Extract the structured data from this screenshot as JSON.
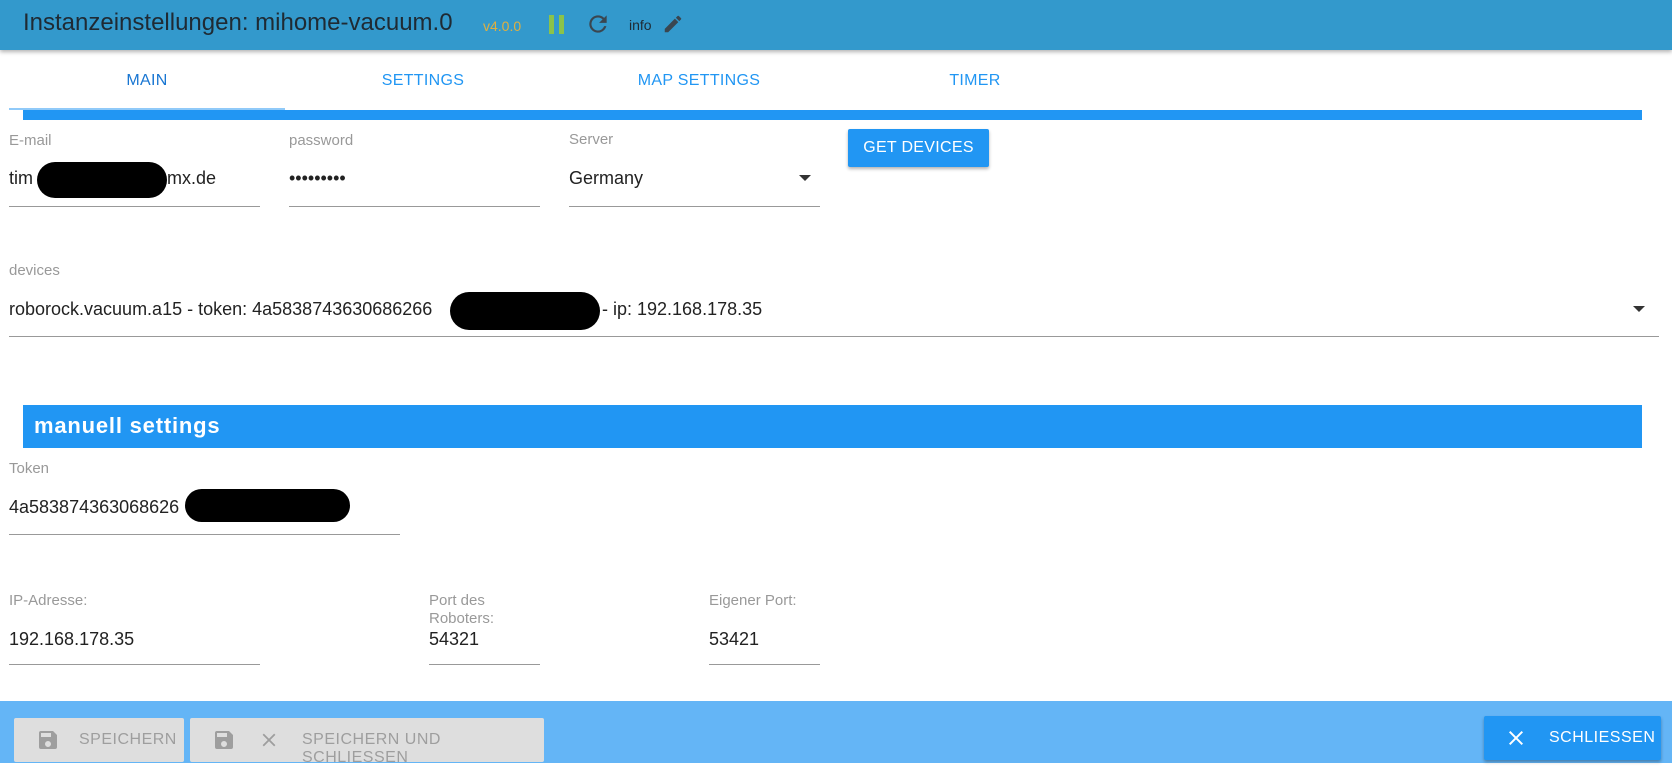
{
  "header": {
    "title": "Instanzeinstellungen: mihome-vacuum.0",
    "version": "v4.0.0",
    "info_label": "info",
    "icons": [
      "pause-icon",
      "reload-icon",
      "edit-icon"
    ]
  },
  "tabs": [
    {
      "label": "MAIN",
      "active": true
    },
    {
      "label": "SETTINGS",
      "active": false
    },
    {
      "label": "MAP SETTINGS",
      "active": false
    },
    {
      "label": "TIMER",
      "active": false
    }
  ],
  "main": {
    "email": {
      "label": "E-mail",
      "value_start": "tim",
      "value_end": "mx.de"
    },
    "password": {
      "label": "password",
      "value": "•••••••••"
    },
    "server": {
      "label": "Server",
      "value": "Germany"
    },
    "get_devices_label": "GET DEVICES",
    "devices": {
      "label": "devices",
      "value_start": "roborock.vacuum.a15 - token: 4a5838743630686266",
      "value_end": "- ip: 192.168.178.35"
    }
  },
  "manual": {
    "section_title": "manuell settings",
    "token": {
      "label": "Token",
      "value": "4a583874363068626"
    },
    "ip": {
      "label": "IP-Adresse:",
      "value": "192.168.178.35"
    },
    "robot_port": {
      "label_line1": "Port des",
      "label_line2": "Roboters:",
      "value": "54321"
    },
    "own_port": {
      "label": "Eigener Port:",
      "value": "53421"
    }
  },
  "footer": {
    "save_label": "SPEICHERN",
    "save_close_label": "SPEICHERN UND SCHLIESSEN",
    "close_label": "SCHLIESSEN"
  },
  "colors": {
    "header_bg": "#3399cc",
    "accent": "#2196f3",
    "footer_bg": "#64b5f6",
    "version": "#e0b040",
    "pause": "#8bc34a"
  }
}
